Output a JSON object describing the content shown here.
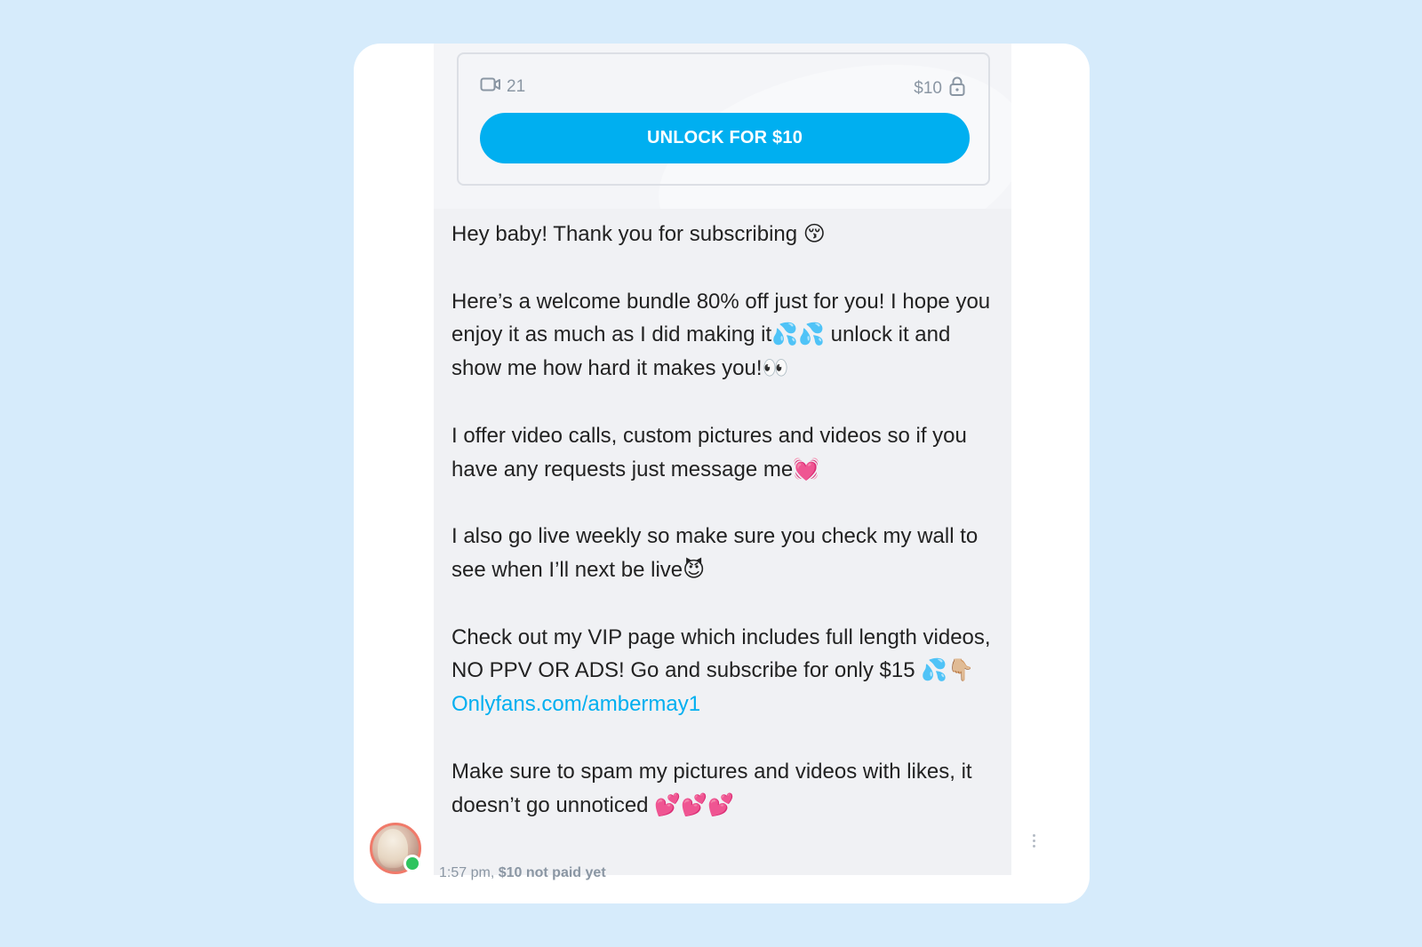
{
  "media": {
    "video_count": "21",
    "price": "$10",
    "unlock_label": "UNLOCK FOR $10"
  },
  "message": {
    "paragraphs": [
      "Hey baby! Thank you for subscribing 😚",
      "Here’s a welcome bundle 80% off just for you! I hope you enjoy it as much as I did making it💦💦 unlock it and show me how hard it makes you!👀",
      "I offer video calls, custom pictures and videos so if you have any requests just message me💓",
      "I also go live weekly so make sure you check my wall to see when I’ll next be live😈",
      "Check out my VIP page which includes full length videos, NO PPV OR ADS! Go and subscribe for only $15 💦👇🏼"
    ],
    "link": "Onlyfans.com/ambermay1",
    "closing": "Make sure to spam my pictures and videos with likes, it doesn’t go unnoticed 💕💕💕"
  },
  "meta": {
    "time": "1:57 pm,",
    "payment_status": "$10 not paid yet"
  },
  "icons": {
    "video": "video-camera-icon",
    "lock": "lock-icon",
    "more": "more-vertical-icon"
  },
  "colors": {
    "accent": "#00aff0",
    "background": "#d6ebfb",
    "bubble": "#f0f1f4",
    "online": "#2fc45f"
  }
}
